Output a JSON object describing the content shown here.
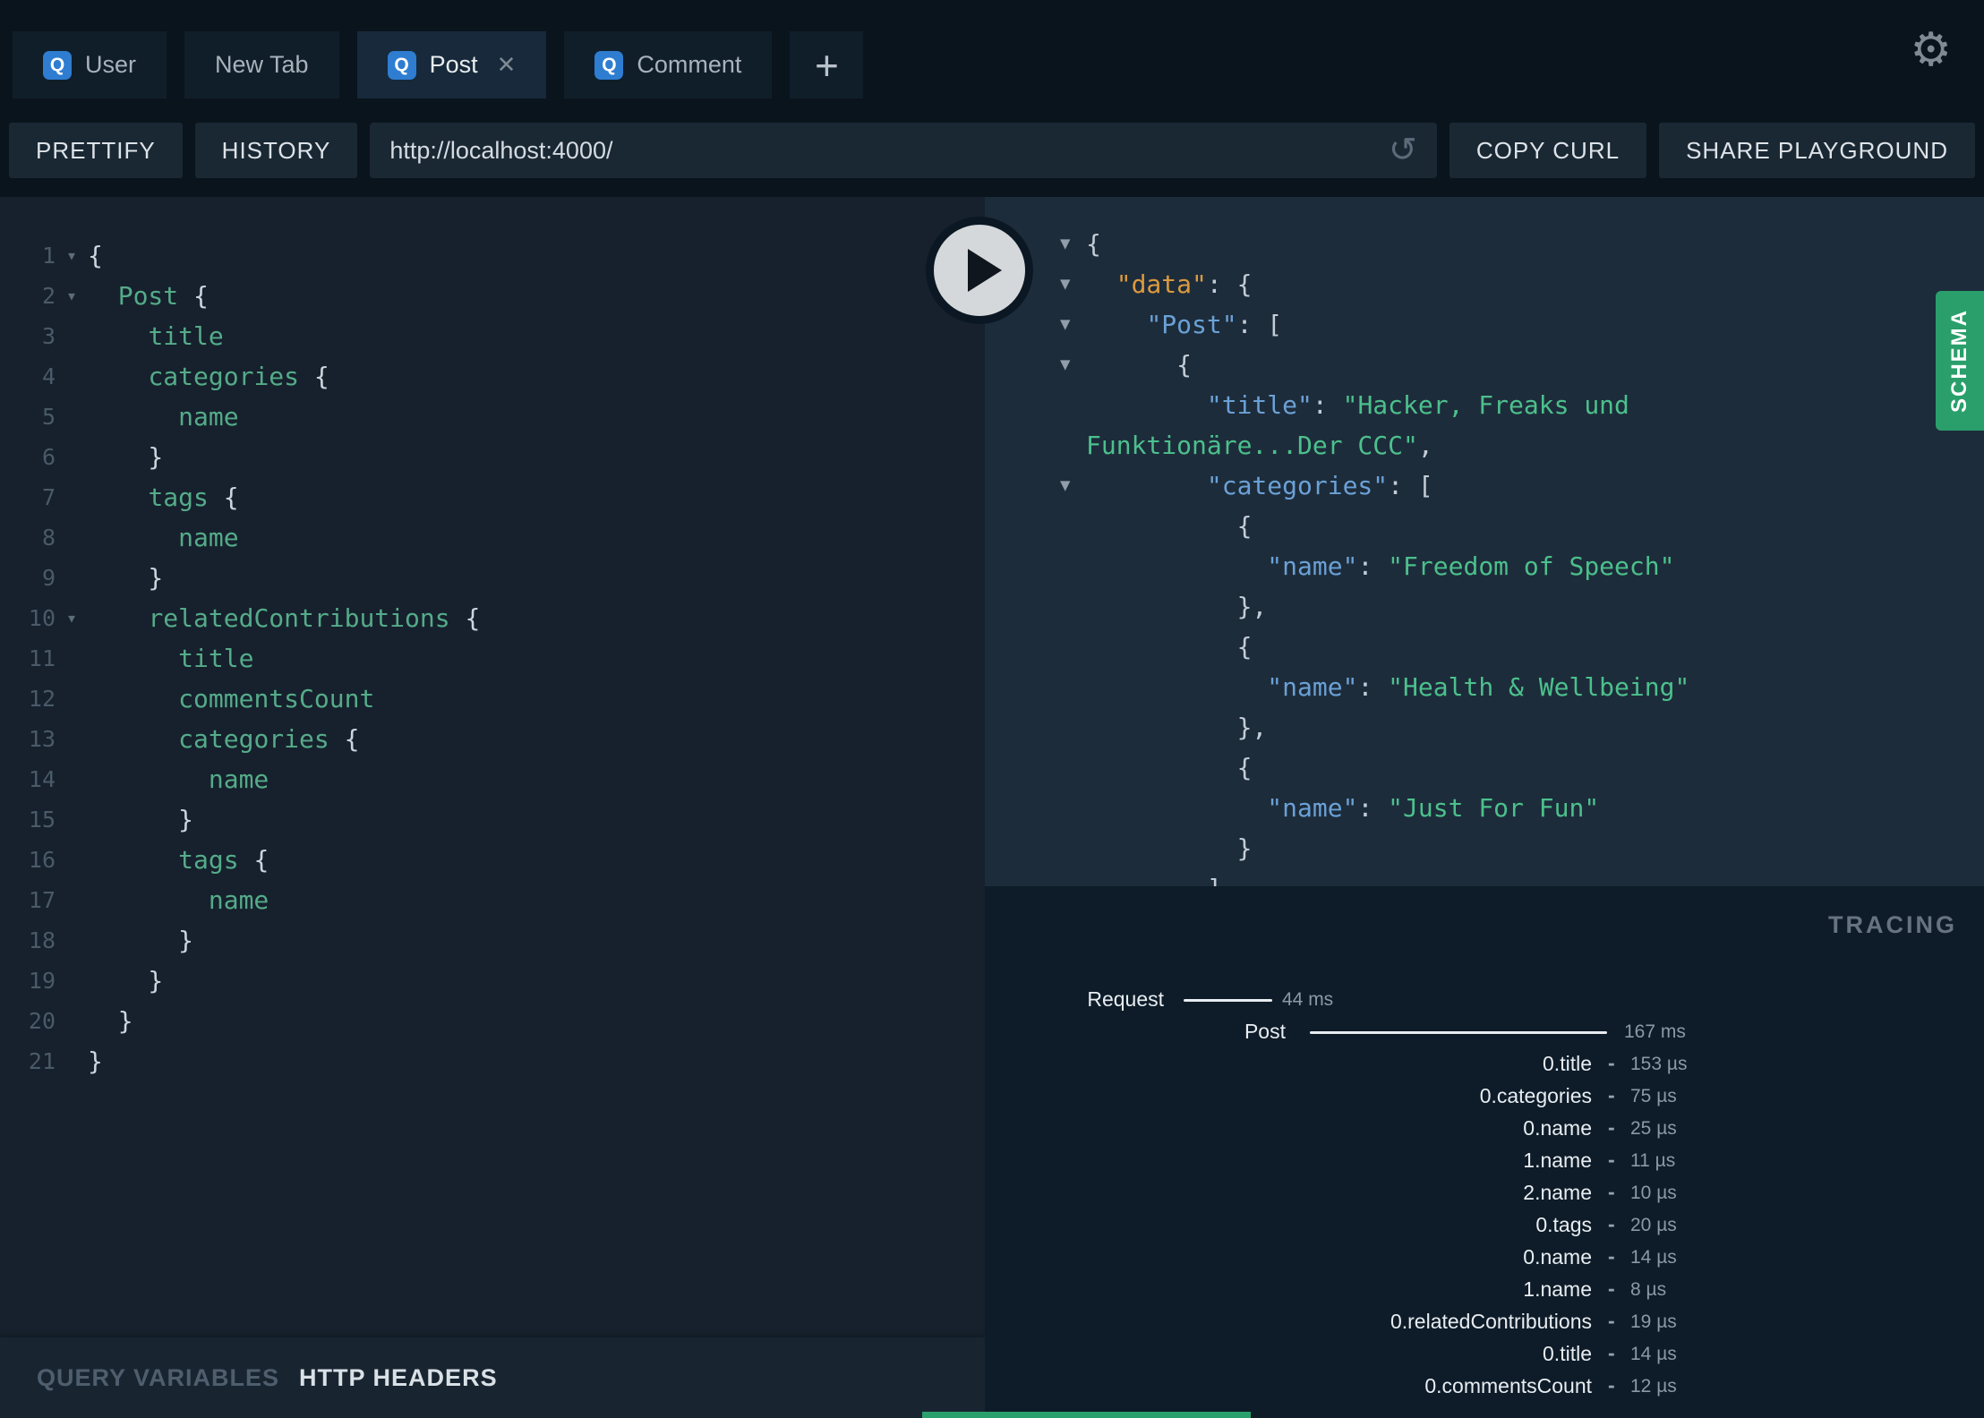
{
  "icons": {
    "settings": "⚙",
    "reload": "↺",
    "plus": "+",
    "close": "✕",
    "fold_arrow": "▾",
    "collapse_arrow": "▼"
  },
  "tabs": {
    "items": [
      {
        "icon": "Q",
        "label": "User",
        "active": false,
        "closable": false
      },
      {
        "icon": null,
        "label": "New Tab",
        "active": false,
        "closable": false
      },
      {
        "icon": "Q",
        "label": "Post",
        "active": true,
        "closable": true
      },
      {
        "icon": "Q",
        "label": "Comment",
        "active": false,
        "closable": false
      }
    ]
  },
  "toolbar": {
    "prettify": "PRETTIFY",
    "history": "HISTORY",
    "url": "http://localhost:4000/",
    "copy_curl": "COPY CURL",
    "share": "SHARE PLAYGROUND"
  },
  "editor": {
    "lines": [
      {
        "code": "{",
        "fold": true
      },
      {
        "code": "  Post {",
        "fold": true
      },
      {
        "code": "    title",
        "fold": false
      },
      {
        "code": "    categories {",
        "fold": false
      },
      {
        "code": "      name",
        "fold": false
      },
      {
        "code": "    }",
        "fold": false
      },
      {
        "code": "    tags {",
        "fold": false
      },
      {
        "code": "      name",
        "fold": false
      },
      {
        "code": "    }",
        "fold": false
      },
      {
        "code": "    relatedContributions {",
        "fold": true
      },
      {
        "code": "      title",
        "fold": false
      },
      {
        "code": "      commentsCount",
        "fold": false
      },
      {
        "code": "      categories {",
        "fold": false
      },
      {
        "code": "        name",
        "fold": false
      },
      {
        "code": "      }",
        "fold": false
      },
      {
        "code": "      tags {",
        "fold": false
      },
      {
        "code": "        name",
        "fold": false
      },
      {
        "code": "      }",
        "fold": false
      },
      {
        "code": "    }",
        "fold": false
      },
      {
        "code": "  }",
        "fold": false
      },
      {
        "code": "}",
        "fold": false
      }
    ]
  },
  "response": {
    "lines": [
      {
        "arrow": true,
        "tokens": [
          [
            "p",
            "{"
          ]
        ]
      },
      {
        "arrow": true,
        "tokens": [
          [
            "p",
            "  "
          ],
          [
            "kd",
            "\"data\""
          ],
          [
            "p",
            ": {"
          ]
        ]
      },
      {
        "arrow": true,
        "tokens": [
          [
            "p",
            "    "
          ],
          [
            "k",
            "\"Post\""
          ],
          [
            "p",
            ": ["
          ]
        ]
      },
      {
        "arrow": true,
        "tokens": [
          [
            "p",
            "      {"
          ]
        ]
      },
      {
        "arrow": false,
        "tokens": [
          [
            "p",
            "        "
          ],
          [
            "k",
            "\"title\""
          ],
          [
            "p",
            ": "
          ],
          [
            "s",
            "\"Hacker, Freaks und"
          ]
        ]
      },
      {
        "arrow": false,
        "tokens": [
          [
            "s",
            "Funktionäre...Der CCC\""
          ],
          [
            "p",
            ","
          ]
        ]
      },
      {
        "arrow": true,
        "tokens": [
          [
            "p",
            "        "
          ],
          [
            "k",
            "\"categories\""
          ],
          [
            "p",
            ": ["
          ]
        ]
      },
      {
        "arrow": false,
        "tokens": [
          [
            "p",
            "          {"
          ]
        ]
      },
      {
        "arrow": false,
        "tokens": [
          [
            "p",
            "            "
          ],
          [
            "k",
            "\"name\""
          ],
          [
            "p",
            ": "
          ],
          [
            "s",
            "\"Freedom of Speech\""
          ]
        ]
      },
      {
        "arrow": false,
        "tokens": [
          [
            "p",
            "          },"
          ]
        ]
      },
      {
        "arrow": false,
        "tokens": [
          [
            "p",
            "          {"
          ]
        ]
      },
      {
        "arrow": false,
        "tokens": [
          [
            "p",
            "            "
          ],
          [
            "k",
            "\"name\""
          ],
          [
            "p",
            ": "
          ],
          [
            "s",
            "\"Health & Wellbeing\""
          ]
        ]
      },
      {
        "arrow": false,
        "tokens": [
          [
            "p",
            "          },"
          ]
        ]
      },
      {
        "arrow": false,
        "tokens": [
          [
            "p",
            "          {"
          ]
        ]
      },
      {
        "arrow": false,
        "tokens": [
          [
            "p",
            "            "
          ],
          [
            "k",
            "\"name\""
          ],
          [
            "p",
            ": "
          ],
          [
            "s",
            "\"Just For Fun\""
          ]
        ]
      },
      {
        "arrow": false,
        "tokens": [
          [
            "p",
            "          }"
          ]
        ]
      },
      {
        "arrow": false,
        "tokens": [
          [
            "p",
            "        ]"
          ]
        ]
      }
    ]
  },
  "schema_tab": "SCHEMA",
  "tracing": {
    "title": "TRACING",
    "rows": [
      {
        "type": "request",
        "label": "Request",
        "value": "44 ms",
        "bar": [
          222,
          99
        ]
      },
      {
        "type": "root",
        "label": "Post",
        "value": "167 ms",
        "bar": [
          363,
          332
        ]
      },
      {
        "type": "field",
        "label": "0.title",
        "value": "153 µs"
      },
      {
        "type": "field",
        "label": "0.categories",
        "value": "75 µs"
      },
      {
        "type": "field",
        "label": "0.name",
        "value": "25 µs"
      },
      {
        "type": "field",
        "label": "1.name",
        "value": "11 µs"
      },
      {
        "type": "field",
        "label": "2.name",
        "value": "10 µs"
      },
      {
        "type": "field",
        "label": "0.tags",
        "value": "20 µs"
      },
      {
        "type": "field",
        "label": "0.name",
        "value": "14 µs"
      },
      {
        "type": "field",
        "label": "1.name",
        "value": "8 µs"
      },
      {
        "type": "field",
        "label": "0.relatedContributions",
        "value": "19 µs"
      },
      {
        "type": "field",
        "label": "0.title",
        "value": "14 µs"
      },
      {
        "type": "field",
        "label": "0.commentsCount",
        "value": "12 µs"
      }
    ]
  },
  "bottom_bar": {
    "query_variables": "QUERY VARIABLES",
    "http_headers": "HTTP HEADERS"
  },
  "colors": {
    "accent_blue": "#2e7dd1",
    "schema_green": "#2a9f6b",
    "field_green": "#55ab89",
    "string_green": "#4cc08c",
    "key_blue": "#6ba1d6",
    "data_orange": "#dc9a3e"
  }
}
